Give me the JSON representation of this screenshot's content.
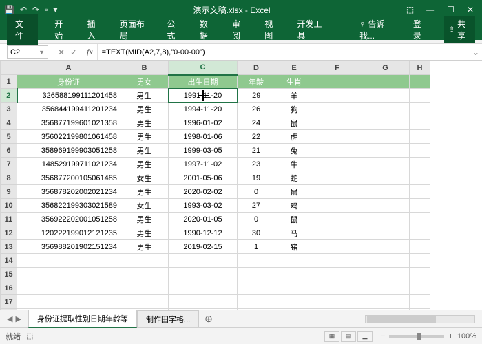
{
  "titlebar": {
    "title": "演示文稿.xlsx - Excel"
  },
  "ribbon": {
    "file": "文件",
    "tabs": [
      "开始",
      "插入",
      "页面布局",
      "公式",
      "数据",
      "审阅",
      "视图",
      "开发工具"
    ],
    "tell_me": "告诉我...",
    "login": "登录",
    "share": "共享"
  },
  "formula": {
    "namebox": "C2",
    "fx": "fx",
    "value": "=TEXT(MID(A2,7,8),\"0-00-00\")"
  },
  "headers": [
    "身份证",
    "男女",
    "出生日期",
    "年龄",
    "生肖"
  ],
  "chart_data": {
    "type": "table",
    "columns": [
      "身份证",
      "男女",
      "出生日期",
      "年龄",
      "生肖"
    ],
    "rows": [
      {
        "id": "326588199111201458",
        "sex": "男生",
        "dob": "1991-11-20",
        "age": "29",
        "zodiac": "羊"
      },
      {
        "id": "356844199411201234",
        "sex": "男生",
        "dob": "1994-11-20",
        "age": "26",
        "zodiac": "狗"
      },
      {
        "id": "356877199601021358",
        "sex": "男生",
        "dob": "1996-01-02",
        "age": "24",
        "zodiac": "鼠"
      },
      {
        "id": "356022199801061458",
        "sex": "男生",
        "dob": "1998-01-06",
        "age": "22",
        "zodiac": "虎"
      },
      {
        "id": "358969199903051258",
        "sex": "男生",
        "dob": "1999-03-05",
        "age": "21",
        "zodiac": "兔"
      },
      {
        "id": "148529199711021234",
        "sex": "男生",
        "dob": "1997-11-02",
        "age": "23",
        "zodiac": "牛"
      },
      {
        "id": "356877200105061485",
        "sex": "女生",
        "dob": "2001-05-06",
        "age": "19",
        "zodiac": "蛇"
      },
      {
        "id": "356878202002021234",
        "sex": "男生",
        "dob": "2020-02-02",
        "age": "0",
        "zodiac": "鼠"
      },
      {
        "id": "356822199303021589",
        "sex": "女生",
        "dob": "1993-03-02",
        "age": "27",
        "zodiac": "鸡"
      },
      {
        "id": "356922202001051258",
        "sex": "男生",
        "dob": "2020-01-05",
        "age": "0",
        "zodiac": "鼠"
      },
      {
        "id": "120222199012121235",
        "sex": "男生",
        "dob": "1990-12-12",
        "age": "30",
        "zodiac": "马"
      },
      {
        "id": "356988201902151234",
        "sex": "男生",
        "dob": "2019-02-15",
        "age": "1",
        "zodiac": "猪"
      }
    ]
  },
  "sheets": {
    "active": "身份证提取性别日期年龄等",
    "other": "制作田字格..."
  },
  "statusbar": {
    "ready": "就绪",
    "macro": "⬚",
    "zoom_pct": "100%"
  }
}
